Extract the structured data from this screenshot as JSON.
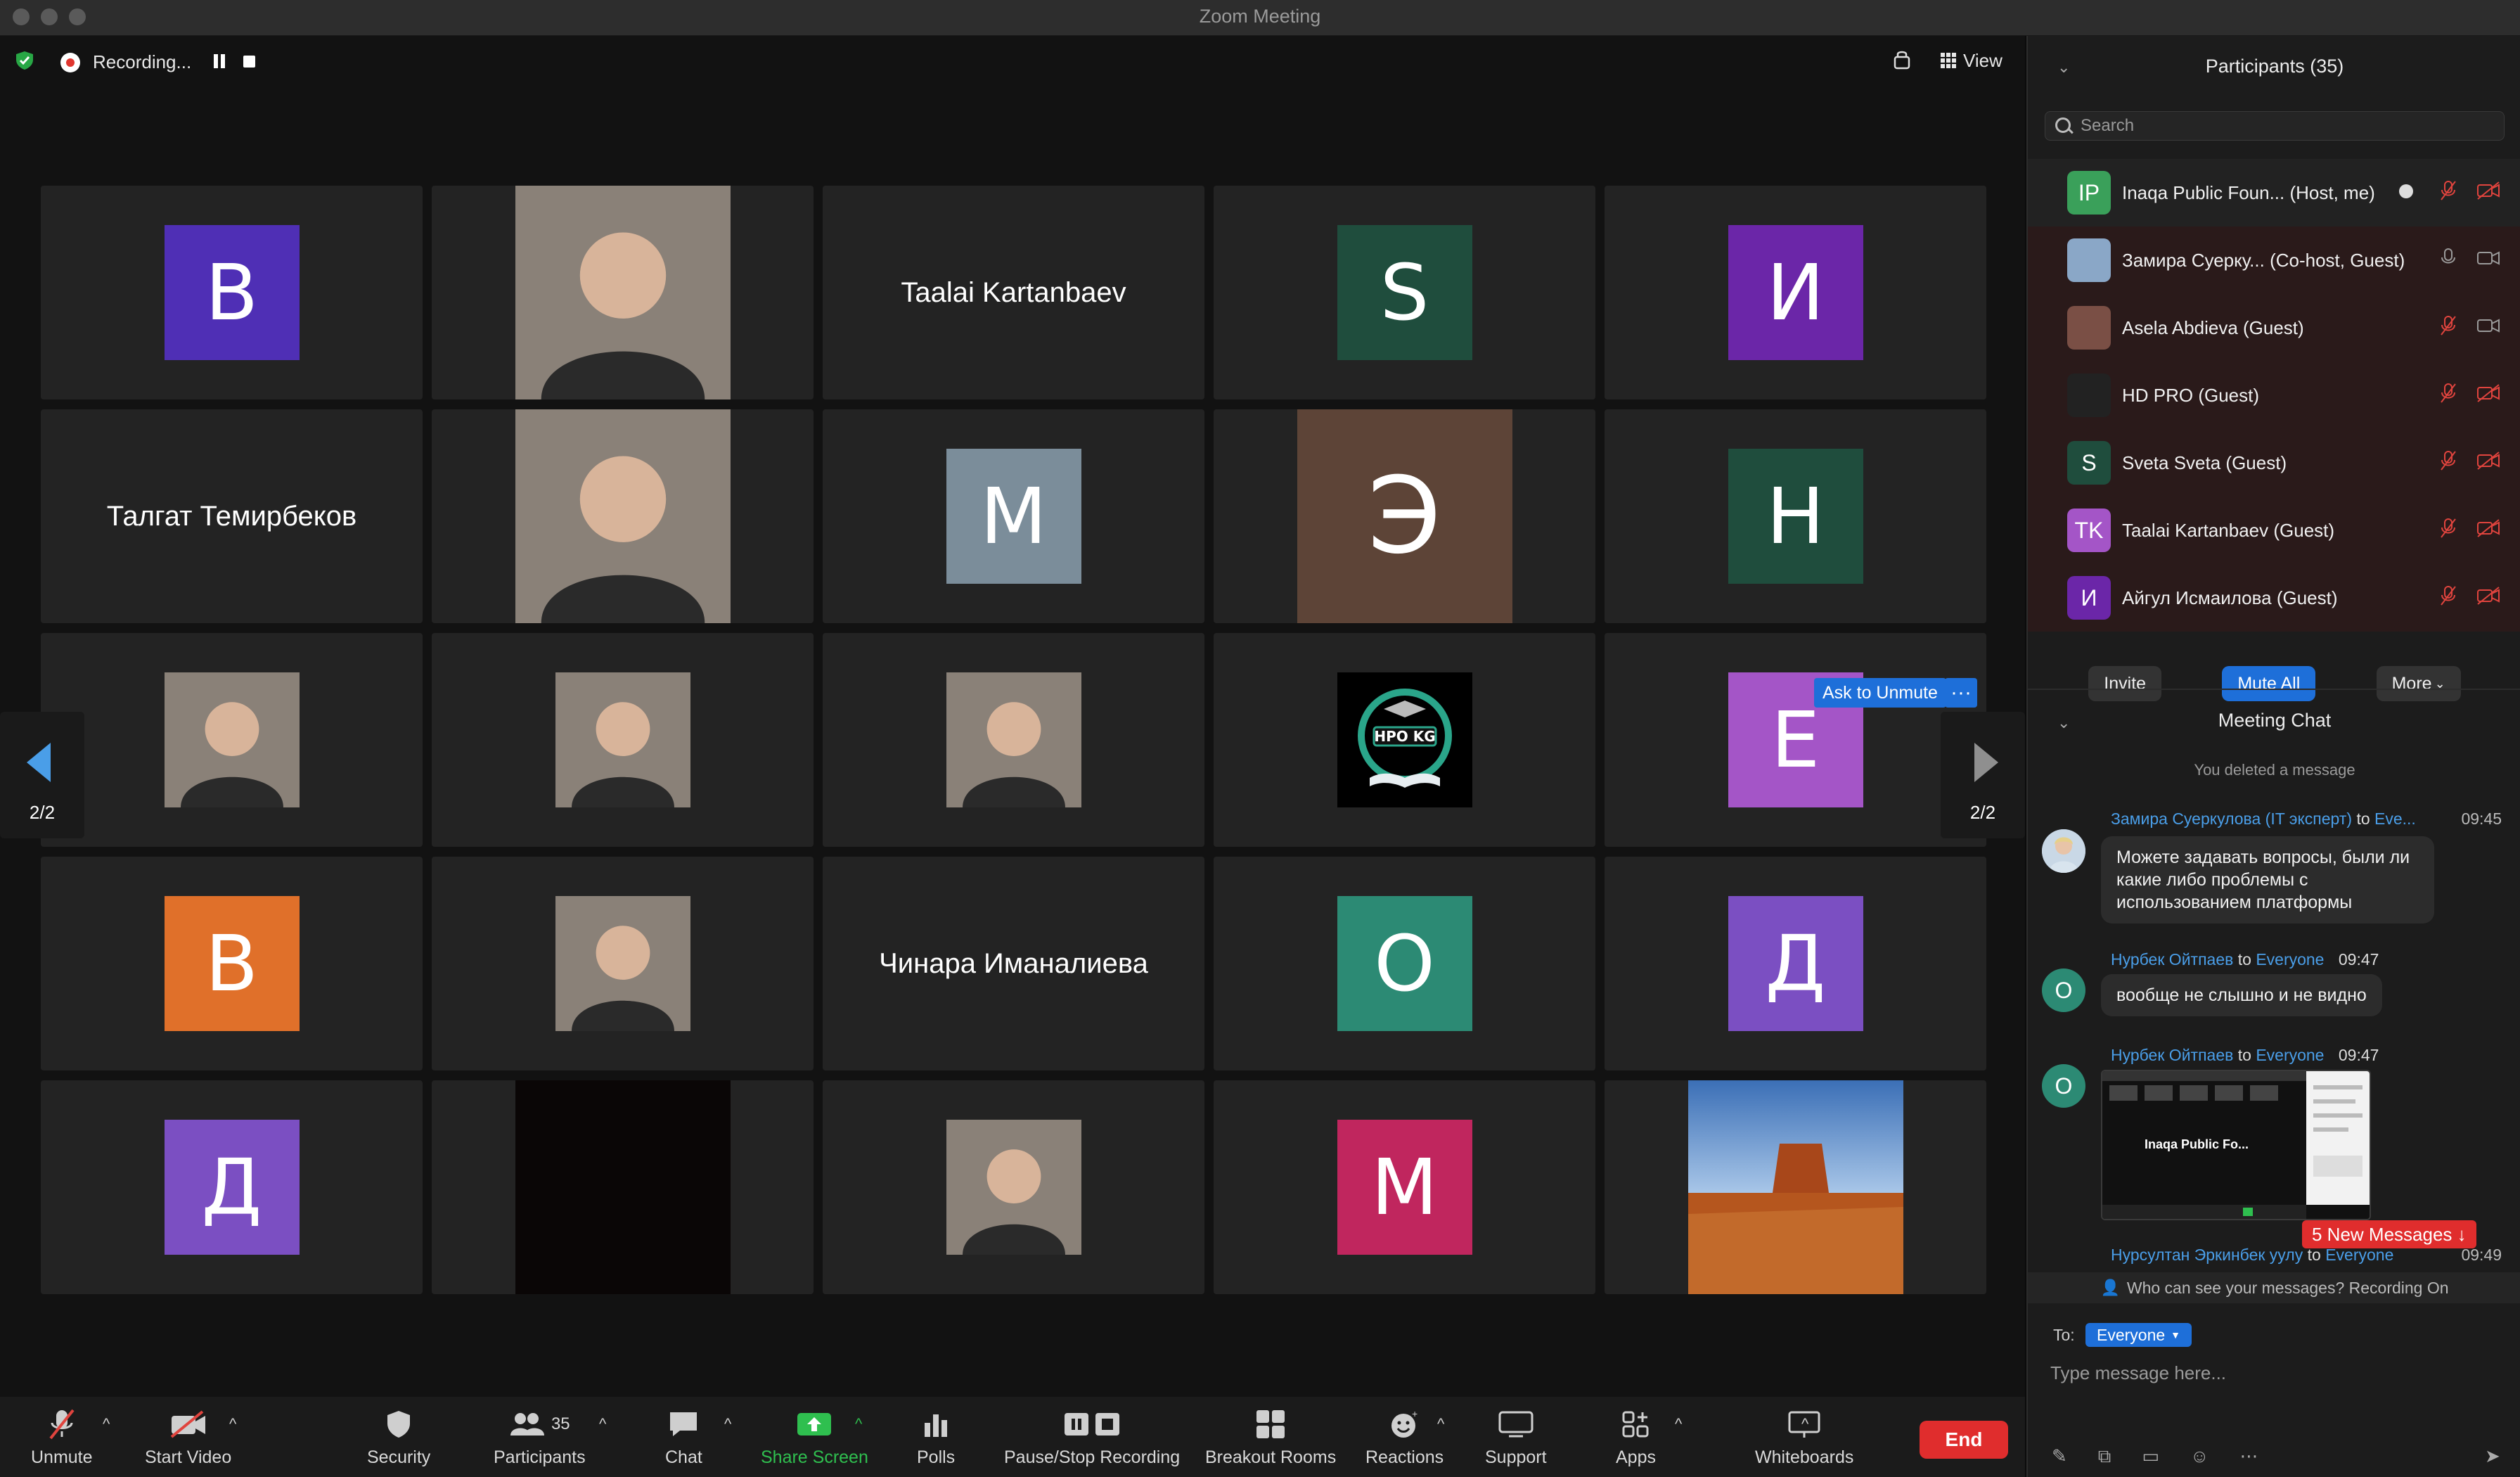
{
  "window": {
    "title": "Zoom Meeting"
  },
  "topbar": {
    "recording_label": "Recording...",
    "view_label": "View"
  },
  "grid": {
    "tiles": [
      {
        "type": "avatar",
        "text": "B",
        "color": "#4f2fb5"
      },
      {
        "type": "photo",
        "text": ""
      },
      {
        "type": "name",
        "text": "Taalai Kartanbaev"
      },
      {
        "type": "avatar",
        "text": "S",
        "color": "#1f4d3d"
      },
      {
        "type": "avatar",
        "text": "И",
        "color": "#6b26a8"
      },
      {
        "type": "name",
        "text": "Талгат Темирбеков"
      },
      {
        "type": "photo",
        "text": ""
      },
      {
        "type": "avatar",
        "text": "M",
        "color": "#7b8d9a"
      },
      {
        "type": "avatar-full",
        "text": "Э",
        "color": "#5d4437"
      },
      {
        "type": "avatar",
        "text": "H",
        "color": "#1f4d3d"
      },
      {
        "type": "photo-sm",
        "text": ""
      },
      {
        "type": "photo-sm",
        "text": ""
      },
      {
        "type": "photo-sm",
        "text": ""
      },
      {
        "type": "logo",
        "text": "HPO KG"
      },
      {
        "type": "avatar",
        "text": "E",
        "color": "#a455c7"
      },
      {
        "type": "avatar",
        "text": "B",
        "color": "#e0702a"
      },
      {
        "type": "photo-sm",
        "text": ""
      },
      {
        "type": "name",
        "text": "Чинара Иманалиева"
      },
      {
        "type": "avatar",
        "text": "O",
        "color": "#2c8a74"
      },
      {
        "type": "avatar",
        "text": "Д",
        "color": "#7b4fc2"
      },
      {
        "type": "avatar",
        "text": "Д",
        "color": "#7b4fc2"
      },
      {
        "type": "photo-dark",
        "text": ""
      },
      {
        "type": "photo-sm",
        "text": ""
      },
      {
        "type": "avatar",
        "text": "M",
        "color": "#c0265e"
      },
      {
        "type": "landscape",
        "text": ""
      }
    ],
    "page_label": "2/2",
    "ask_unmute_label": "Ask to Unmute",
    "more_label": "···"
  },
  "toolbar": {
    "unmute": "Unmute",
    "start_video": "Start Video",
    "security": "Security",
    "participants": "Participants",
    "participants_count": "35",
    "chat": "Chat",
    "share_screen": "Share Screen",
    "polls": "Polls",
    "pause_stop": "Pause/Stop Recording",
    "breakout": "Breakout Rooms",
    "reactions": "Reactions",
    "support": "Support",
    "apps": "Apps",
    "whiteboards": "Whiteboards",
    "end": "End"
  },
  "participants": {
    "title": "Participants (35)",
    "search_placeholder": "Search",
    "list": [
      {
        "initials": "IP",
        "color": "#3aa05a",
        "name": "Inaqa Public Foun...  (Host, me)"
      },
      {
        "initials": "",
        "color": "#8aa7c7",
        "name": "Замира Суерку...  (Co-host, Guest)"
      },
      {
        "initials": "",
        "color": "#7a4f45",
        "name": "Asela Abdieva (Guest)"
      },
      {
        "initials": "",
        "color": "#222",
        "name": "HD PRO (Guest)"
      },
      {
        "initials": "S",
        "color": "#1f4d3d",
        "name": "Sveta Sveta (Guest)"
      },
      {
        "initials": "TK",
        "color": "#a455c7",
        "name": "Taalai Kartanbaev (Guest)"
      },
      {
        "initials": "И",
        "color": "#6b26a8",
        "name": "Айгул Исмаилова (Guest)"
      }
    ],
    "invite": "Invite",
    "mute_all": "Mute All",
    "more": "More"
  },
  "chat": {
    "title": "Meeting Chat",
    "deleted": "You deleted a message",
    "messages": [
      {
        "from": "Замира Суеркулова (IT эксперт)",
        "to_word": "to",
        "to": "Eve...",
        "time": "09:45",
        "text": "Можете задавать вопросы, были ли какие либо проблемы с использованием платформы"
      },
      {
        "from": "Нурбек Ойтпаев",
        "to_word": "to",
        "to": "Everyone",
        "time": "09:47",
        "text": "вообще не слышно и не видно"
      },
      {
        "from": "Нурбек Ойтпаев",
        "to_word": "to",
        "to": "Everyone",
        "time": "09:47",
        "text": "Inaqa Public Fo..."
      },
      {
        "from": "Нурсултан Эркинбек уулу",
        "to_word": "to",
        "to": "Everyone",
        "time": "09:49",
        "text": ""
      }
    ],
    "avatar_letter": "O",
    "new_messages": "5 New Messages ↓",
    "who_can_see": "Who can see your messages? Recording On",
    "to_label": "To:",
    "to_value": "Everyone",
    "input_placeholder": "Type message here..."
  }
}
